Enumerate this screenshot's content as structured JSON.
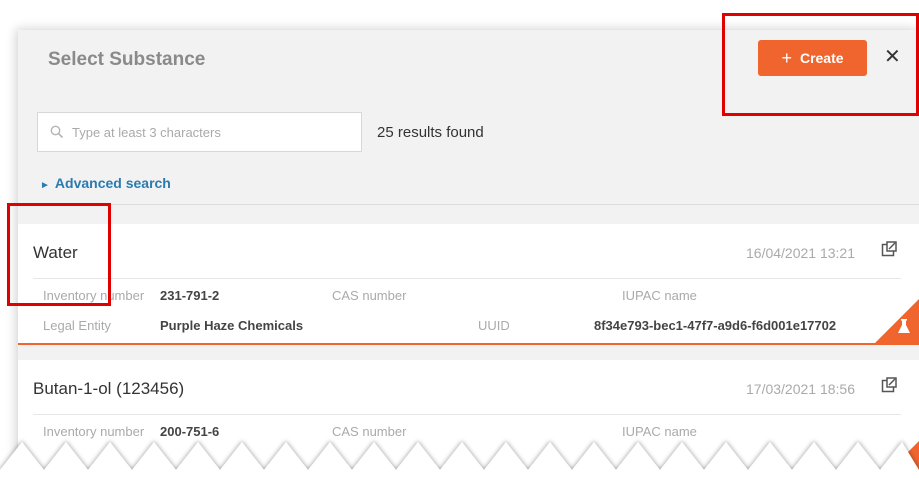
{
  "dialog": {
    "title": "Select Substance",
    "create_label": "Create",
    "close_symbol": "✕"
  },
  "search": {
    "placeholder": "Type at least 3 characters",
    "value": "",
    "results_text": "25 results found"
  },
  "advanced_search_label": "Advanced search",
  "results": [
    {
      "name": "Water",
      "date": "16/04/2021 13:21",
      "inventory_label": "Inventory number",
      "inventory_value": "231-791-2",
      "cas_label": "CAS number",
      "cas_value": "",
      "iupac_label": "IUPAC name",
      "iupac_value": "",
      "legal_label": "Legal Entity",
      "legal_value": "Purple Haze Chemicals",
      "uuid_label": "UUID",
      "uuid_value": "8f34e793-bec1-47f7-a9d6-f6d001e17702"
    },
    {
      "name": "Butan-1-ol (123456)",
      "date": "17/03/2021 18:56",
      "inventory_label": "Inventory number",
      "inventory_value": "200-751-6",
      "cas_label": "CAS number",
      "cas_value": "",
      "iupac_label": "IUPAC name",
      "iupac_value": ""
    }
  ],
  "colors": {
    "accent": "#f0642d",
    "link": "#2c7bb0",
    "highlight_box": "#e00000",
    "panel_bg": "#f2f2f2"
  },
  "icons": [
    "search-icon",
    "close-icon",
    "external-link-icon",
    "flask-icon",
    "plus-icon"
  ]
}
